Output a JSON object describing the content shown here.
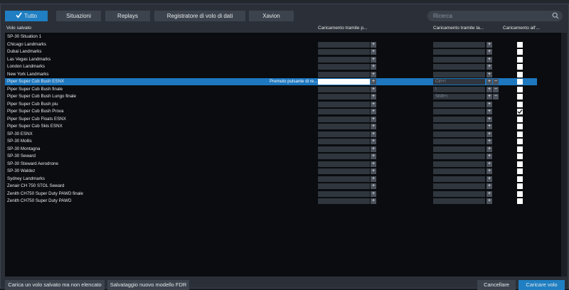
{
  "tabs": [
    {
      "label": "Tutto",
      "active": true
    },
    {
      "label": "Situazioni",
      "active": false
    },
    {
      "label": "Replays",
      "active": false
    },
    {
      "label": "Registratore di volo di dati",
      "active": false
    },
    {
      "label": "Xavion",
      "active": false
    }
  ],
  "search": {
    "placeholder": "Ricerca",
    "icon": "search-icon"
  },
  "columns": {
    "name": "Volo salvato",
    "load_a": "Caricamento tramite p...",
    "load_b": "Caricamento tramite ta...",
    "load_start": "Caricamento all'..."
  },
  "rows": [
    {
      "name": "SP-30 Situation 1",
      "show_controls": false
    },
    {
      "name": "Chicago Landmarks",
      "show_controls": true,
      "key": "",
      "checked": false
    },
    {
      "name": "Dubai Landmarks",
      "show_controls": true,
      "key": "",
      "checked": false
    },
    {
      "name": "Las Vegas Landmarks",
      "show_controls": true,
      "key": "",
      "checked": false
    },
    {
      "name": "London Landmarks",
      "show_controls": true,
      "key": "",
      "checked": false
    },
    {
      "name": "New York Landmarks",
      "show_controls": true,
      "key": "",
      "checked": false
    },
    {
      "name": "Piper Super Cub Bush ESNX",
      "show_controls": true,
      "selected": true,
      "hint": "Premuto pulsante di re...",
      "key": "Ctrl+\\",
      "checked": false,
      "minus": true
    },
    {
      "name": "Piper Super Cub Bush finale",
      "show_controls": true,
      "key": "\\",
      "checked": false,
      "minus": true
    },
    {
      "name": "Piper Super Cub Bush Lungo finale",
      "show_controls": true,
      "key": "Shift+\\",
      "checked": false,
      "minus": true
    },
    {
      "name": "Piper Super Cub Bush piu",
      "show_controls": true,
      "key": "",
      "checked": false
    },
    {
      "name": "Piper Super Cub Bush Prova",
      "show_controls": true,
      "key": "",
      "checked": true
    },
    {
      "name": "Piper Super Cub Floats ESNX",
      "show_controls": true,
      "key": "",
      "checked": false
    },
    {
      "name": "Piper Super Cub Skis ESNX",
      "show_controls": true,
      "key": "",
      "checked": false
    },
    {
      "name": "SP-30 ESNX",
      "show_controls": true,
      "key": "",
      "checked": false
    },
    {
      "name": "SP-30 Mollis",
      "show_controls": true,
      "key": "",
      "checked": false
    },
    {
      "name": "SP-30 Montagna",
      "show_controls": true,
      "key": "",
      "checked": false
    },
    {
      "name": "SP-30 Seward",
      "show_controls": true,
      "key": "",
      "checked": false
    },
    {
      "name": "SP-30 Steward Aerodrone",
      "show_controls": true,
      "key": "",
      "checked": false
    },
    {
      "name": "SP-30 Waldez",
      "show_controls": true,
      "key": "",
      "checked": false
    },
    {
      "name": "Sydney Landmarks",
      "show_controls": true,
      "key": "",
      "checked": false
    },
    {
      "name": "Zenair CH 750 STOL Seward",
      "show_controls": true,
      "key": "",
      "checked": false
    },
    {
      "name": "Zenith CH750 Super Duty PAWD finale",
      "show_controls": true,
      "key": "",
      "checked": false
    },
    {
      "name": "Zenith CH750 Super Duty PAWD",
      "show_controls": true,
      "key": "",
      "checked": false
    }
  ],
  "footer": {
    "load_unlisted": "Carica un volo salvato ma non elencato",
    "save_fdr": "Salvataggio nuovo modello FDR",
    "cancel": "Cancellare",
    "load": "Caricare volo"
  },
  "colors": {
    "accent": "#1f7fc2",
    "panel": "#2b3038",
    "list_bg": "#0a0c0f"
  }
}
